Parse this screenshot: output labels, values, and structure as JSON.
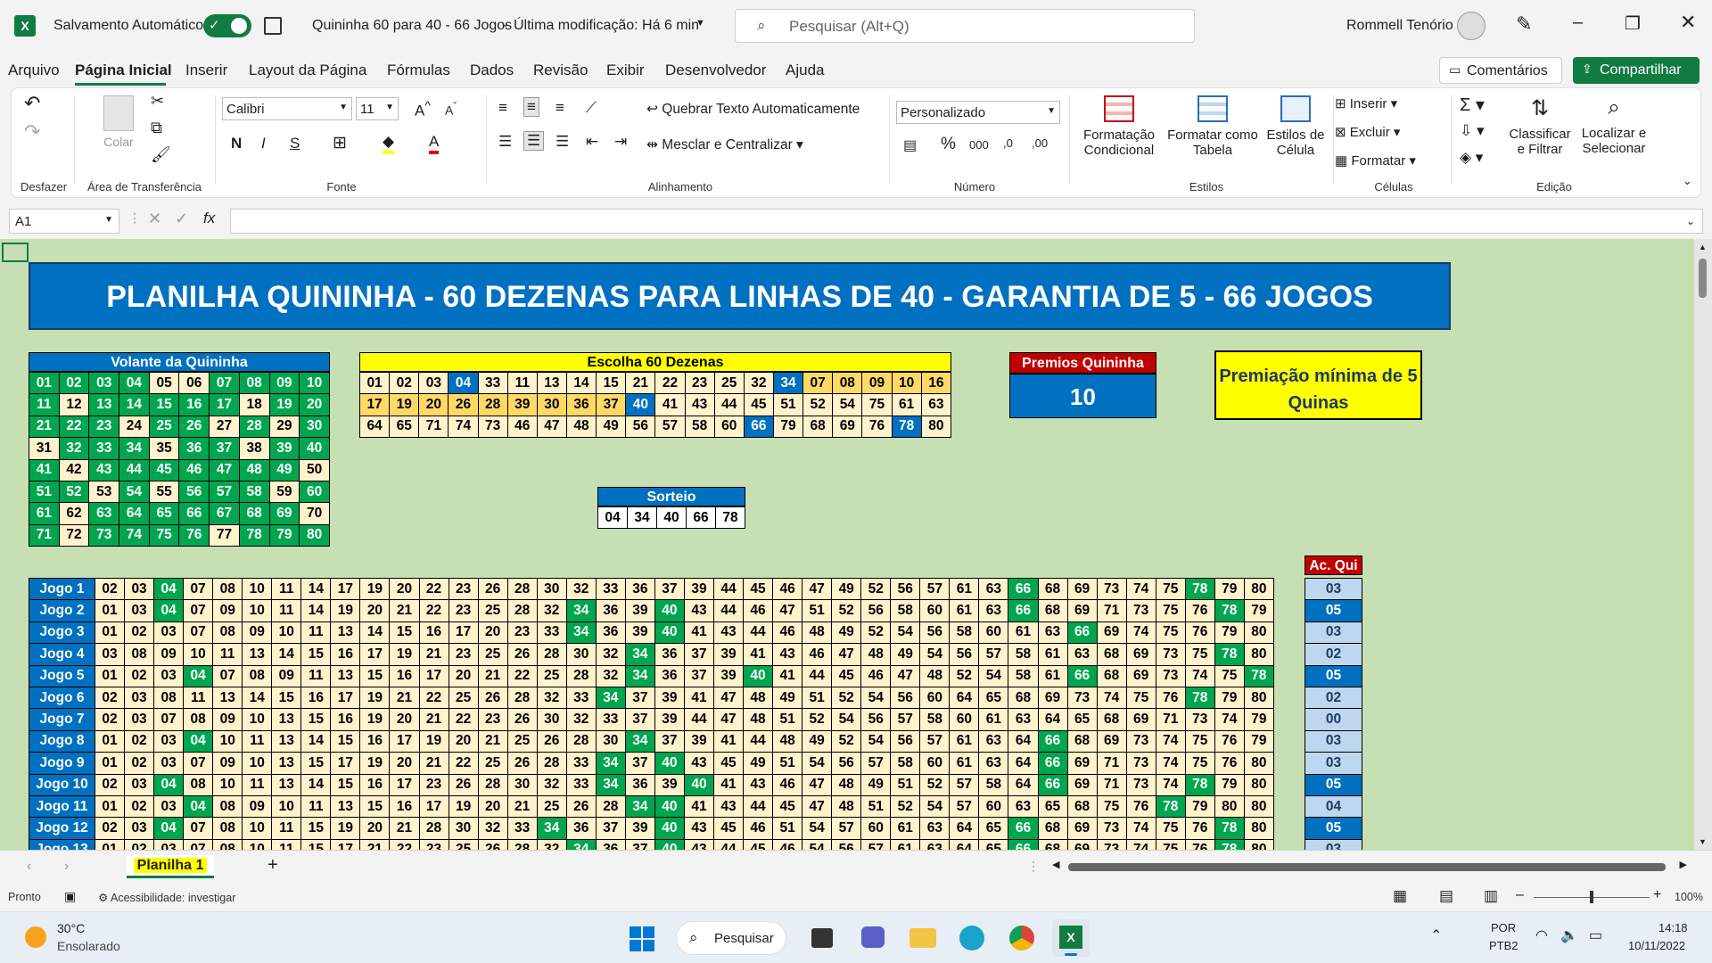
{
  "titlebar": {
    "autosave_label": "Salvamento Automático",
    "doc_title": "Quininha 60 para 40 - 66 Jogos",
    "modified": "Última modificação: Há 6 min",
    "search_placeholder": "Pesquisar (Alt+Q)",
    "user": "Rommell Tenório"
  },
  "menu": [
    "Arquivo",
    "Página Inicial",
    "Inserir",
    "Layout da Página",
    "Fórmulas",
    "Dados",
    "Revisão",
    "Exibir",
    "Desenvolvedor",
    "Ajuda"
  ],
  "menu_right": {
    "comments": "Comentários",
    "share": "Compartilhar"
  },
  "ribbon": {
    "undo_group": "Desfazer",
    "paste": "Colar",
    "clipboard_group": "Área de Transferência",
    "font_name": "Calibri",
    "font_size": "11",
    "font_group": "Fonte",
    "bold": "N",
    "italic": "I",
    "underline": "S",
    "wrap_text": "Quebrar Texto Automaticamente",
    "merge_center": "Mesclar e Centralizar",
    "align_group": "Alinhamento",
    "number_format": "Personalizado",
    "number_group": "Número",
    "cond_format_1": "Formatação",
    "cond_format_2": "Condicional",
    "format_table_1": "Formatar como",
    "format_table_2": "Tabela",
    "cell_styles_1": "Estilos de",
    "cell_styles_2": "Célula",
    "styles_group": "Estilos",
    "insert": "Inserir",
    "delete": "Excluir",
    "format": "Formatar",
    "cells_group": "Células",
    "sort_1": "Classificar",
    "sort_2": "e Filtrar",
    "find_1": "Localizar e",
    "find_2": "Selecionar",
    "edit_group": "Edição"
  },
  "formula": {
    "name_box": "A1",
    "fx": "fx",
    "value": ""
  },
  "sheet": {
    "banner": "PLANILHA QUININHA - 60 DEZENAS PARA LINHAS DE 40 - GARANTIA DE 5 - 66 JOGOS",
    "volante_title": "Volante da Quininha",
    "volante": [
      [
        "01",
        "02",
        "03",
        "04",
        "05",
        "06",
        "07",
        "08",
        "09",
        "10"
      ],
      [
        "11",
        "12",
        "13",
        "14",
        "15",
        "16",
        "17",
        "18",
        "19",
        "20"
      ],
      [
        "21",
        "22",
        "23",
        "24",
        "25",
        "26",
        "27",
        "28",
        "29",
        "30"
      ],
      [
        "31",
        "32",
        "33",
        "34",
        "35",
        "36",
        "37",
        "38",
        "39",
        "40"
      ],
      [
        "41",
        "42",
        "43",
        "44",
        "45",
        "46",
        "47",
        "48",
        "49",
        "50"
      ],
      [
        "51",
        "52",
        "53",
        "54",
        "55",
        "56",
        "57",
        "58",
        "59",
        "60"
      ],
      [
        "61",
        "62",
        "63",
        "64",
        "65",
        "66",
        "67",
        "68",
        "69",
        "70"
      ],
      [
        "71",
        "72",
        "73",
        "74",
        "75",
        "76",
        "77",
        "78",
        "79",
        "80"
      ]
    ],
    "volante_white": [
      "05",
      "06",
      "12",
      "18",
      "24",
      "27",
      "29",
      "31",
      "35",
      "38",
      "42",
      "50",
      "53",
      "55",
      "59",
      "62",
      "70",
      "72",
      "77"
    ],
    "escolha_title": "Escolha 60 Dezenas",
    "escolha": [
      [
        "01",
        "02",
        "03",
        "04",
        "33",
        "11",
        "13",
        "14",
        "15",
        "21",
        "22",
        "23",
        "25",
        "32",
        "34",
        "07",
        "08",
        "09",
        "10",
        "16"
      ],
      [
        "17",
        "19",
        "20",
        "26",
        "28",
        "39",
        "30",
        "36",
        "37",
        "40",
        "41",
        "43",
        "44",
        "45",
        "51",
        "52",
        "54",
        "75",
        "61",
        "63"
      ],
      [
        "64",
        "65",
        "71",
        "74",
        "73",
        "46",
        "47",
        "48",
        "49",
        "56",
        "57",
        "58",
        "60",
        "66",
        "79",
        "68",
        "69",
        "76",
        "78",
        "80"
      ]
    ],
    "escolha_blue": [
      "04",
      "34",
      "40",
      "66",
      "78"
    ],
    "escolha_yellow": [
      "07",
      "08",
      "09",
      "10",
      "16",
      "17",
      "19",
      "20",
      "26",
      "28",
      "39",
      "30",
      "36",
      "37"
    ],
    "premios_title": "Premios Quininha",
    "premios_value": "10",
    "premiacao": "Premiação mínima de 5 Quinas",
    "sorteio_title": "Sorteio",
    "sorteio": [
      "04",
      "34",
      "40",
      "66",
      "78"
    ],
    "acqui_title": "Ac. Qui",
    "jogos": [
      {
        "label": "Jogo 1",
        "nums": [
          "02",
          "03",
          "04",
          "07",
          "08",
          "10",
          "11",
          "14",
          "17",
          "19",
          "20",
          "22",
          "23",
          "26",
          "28",
          "30",
          "32",
          "33",
          "36",
          "37",
          "39",
          "44",
          "45",
          "46",
          "47",
          "49",
          "52",
          "56",
          "57",
          "61",
          "63",
          "66",
          "68",
          "69",
          "73",
          "74",
          "75",
          "78",
          "79",
          "80"
        ],
        "ac": "03"
      },
      {
        "label": "Jogo 2",
        "nums": [
          "01",
          "03",
          "04",
          "07",
          "09",
          "10",
          "11",
          "14",
          "19",
          "20",
          "21",
          "22",
          "23",
          "25",
          "28",
          "32",
          "34",
          "36",
          "39",
          "40",
          "43",
          "44",
          "46",
          "47",
          "51",
          "52",
          "56",
          "58",
          "60",
          "61",
          "63",
          "66",
          "68",
          "69",
          "71",
          "73",
          "75",
          "76",
          "78",
          "79"
        ],
        "ac": "05"
      },
      {
        "label": "Jogo 3",
        "nums": [
          "01",
          "02",
          "03",
          "07",
          "08",
          "09",
          "10",
          "11",
          "13",
          "14",
          "15",
          "16",
          "17",
          "20",
          "23",
          "33",
          "34",
          "36",
          "39",
          "40",
          "41",
          "43",
          "44",
          "46",
          "48",
          "49",
          "52",
          "54",
          "56",
          "58",
          "60",
          "61",
          "63",
          "66",
          "69",
          "74",
          "75",
          "76",
          "79",
          "80"
        ],
        "ac": "03"
      },
      {
        "label": "Jogo 4",
        "nums": [
          "03",
          "08",
          "09",
          "10",
          "11",
          "13",
          "14",
          "15",
          "16",
          "17",
          "19",
          "21",
          "23",
          "25",
          "26",
          "28",
          "30",
          "32",
          "34",
          "36",
          "37",
          "39",
          "41",
          "43",
          "46",
          "47",
          "48",
          "49",
          "54",
          "56",
          "57",
          "58",
          "61",
          "63",
          "68",
          "69",
          "73",
          "75",
          "78",
          "80"
        ],
        "ac": "02"
      },
      {
        "label": "Jogo 5",
        "nums": [
          "01",
          "02",
          "03",
          "04",
          "07",
          "08",
          "09",
          "11",
          "13",
          "15",
          "16",
          "17",
          "20",
          "21",
          "22",
          "25",
          "28",
          "32",
          "34",
          "36",
          "37",
          "39",
          "40",
          "41",
          "44",
          "45",
          "46",
          "47",
          "48",
          "52",
          "54",
          "58",
          "61",
          "66",
          "68",
          "69",
          "73",
          "74",
          "75",
          "78"
        ],
        "ac": "05"
      },
      {
        "label": "Jogo 6",
        "nums": [
          "02",
          "03",
          "08",
          "11",
          "13",
          "14",
          "15",
          "16",
          "17",
          "19",
          "21",
          "22",
          "25",
          "26",
          "28",
          "32",
          "33",
          "34",
          "37",
          "39",
          "41",
          "47",
          "48",
          "49",
          "51",
          "52",
          "54",
          "56",
          "60",
          "64",
          "65",
          "68",
          "69",
          "73",
          "74",
          "75",
          "76",
          "78",
          "79",
          "80"
        ],
        "ac": "02"
      },
      {
        "label": "Jogo 7",
        "nums": [
          "02",
          "03",
          "07",
          "08",
          "09",
          "10",
          "13",
          "15",
          "16",
          "19",
          "20",
          "21",
          "22",
          "23",
          "26",
          "30",
          "32",
          "33",
          "37",
          "39",
          "44",
          "47",
          "48",
          "51",
          "52",
          "54",
          "56",
          "57",
          "58",
          "60",
          "61",
          "63",
          "64",
          "65",
          "68",
          "69",
          "71",
          "73",
          "74",
          "79"
        ],
        "ac": "00"
      },
      {
        "label": "Jogo 8",
        "nums": [
          "01",
          "02",
          "03",
          "04",
          "10",
          "11",
          "13",
          "14",
          "15",
          "16",
          "17",
          "19",
          "20",
          "21",
          "25",
          "26",
          "28",
          "30",
          "34",
          "37",
          "39",
          "41",
          "44",
          "48",
          "49",
          "52",
          "54",
          "56",
          "57",
          "61",
          "63",
          "64",
          "66",
          "68",
          "69",
          "73",
          "74",
          "75",
          "76",
          "79"
        ],
        "ac": "03"
      },
      {
        "label": "Jogo 9",
        "nums": [
          "01",
          "02",
          "03",
          "07",
          "09",
          "10",
          "13",
          "15",
          "17",
          "19",
          "20",
          "21",
          "22",
          "25",
          "26",
          "28",
          "33",
          "34",
          "37",
          "40",
          "43",
          "45",
          "49",
          "51",
          "54",
          "56",
          "57",
          "58",
          "60",
          "61",
          "63",
          "64",
          "66",
          "69",
          "71",
          "73",
          "74",
          "75",
          "76",
          "80"
        ],
        "ac": "03"
      },
      {
        "label": "Jogo 10",
        "nums": [
          "02",
          "03",
          "04",
          "08",
          "10",
          "11",
          "13",
          "14",
          "15",
          "16",
          "17",
          "23",
          "26",
          "28",
          "30",
          "32",
          "33",
          "34",
          "36",
          "39",
          "40",
          "41",
          "43",
          "46",
          "47",
          "48",
          "49",
          "51",
          "52",
          "57",
          "58",
          "64",
          "66",
          "69",
          "71",
          "73",
          "74",
          "78",
          "79",
          "80"
        ],
        "ac": "05"
      },
      {
        "label": "Jogo 11",
        "nums": [
          "01",
          "02",
          "03",
          "04",
          "08",
          "09",
          "10",
          "11",
          "13",
          "15",
          "16",
          "17",
          "19",
          "20",
          "21",
          "25",
          "26",
          "28",
          "34",
          "40",
          "41",
          "43",
          "44",
          "45",
          "47",
          "48",
          "51",
          "52",
          "54",
          "57",
          "60",
          "63",
          "65",
          "68",
          "75",
          "76",
          "78",
          "79",
          "80",
          "80"
        ],
        "ac": "04"
      },
      {
        "label": "Jogo 12",
        "nums": [
          "02",
          "03",
          "04",
          "07",
          "08",
          "10",
          "11",
          "15",
          "19",
          "20",
          "21",
          "28",
          "30",
          "32",
          "33",
          "34",
          "36",
          "37",
          "39",
          "40",
          "43",
          "45",
          "46",
          "51",
          "54",
          "57",
          "60",
          "61",
          "63",
          "64",
          "65",
          "66",
          "68",
          "69",
          "73",
          "74",
          "75",
          "76",
          "78",
          "80"
        ],
        "ac": "05"
      },
      {
        "label": "Jogo 13",
        "nums": [
          "01",
          "02",
          "03",
          "07",
          "08",
          "10",
          "11",
          "15",
          "17",
          "21",
          "22",
          "23",
          "25",
          "26",
          "28",
          "32",
          "34",
          "36",
          "37",
          "40",
          "43",
          "44",
          "45",
          "46",
          "54",
          "56",
          "57",
          "61",
          "63",
          "64",
          "65",
          "66",
          "68",
          "69",
          "73",
          "74",
          "75",
          "76",
          "78",
          "80"
        ],
        "ac": "03"
      }
    ],
    "tab": "Planilha 1",
    "new_tab": "+"
  },
  "status": {
    "ready": "Pronto",
    "accessibility": "Acessibilidade: investigar",
    "zoom": "100%"
  },
  "taskbar": {
    "temp": "30°C",
    "weather": "Ensolarado",
    "search": "Pesquisar",
    "lang1": "POR",
    "lang2": "PTB2",
    "time": "14:18",
    "date": "10/11/2022"
  },
  "colors": {
    "green": "#00a64f",
    "blue": "#0070c0",
    "yellow": "#ffff00",
    "cream": "#fff2cc",
    "sheet_bg": "#c6e0b4",
    "red": "#c00000",
    "share": "#107c41"
  }
}
